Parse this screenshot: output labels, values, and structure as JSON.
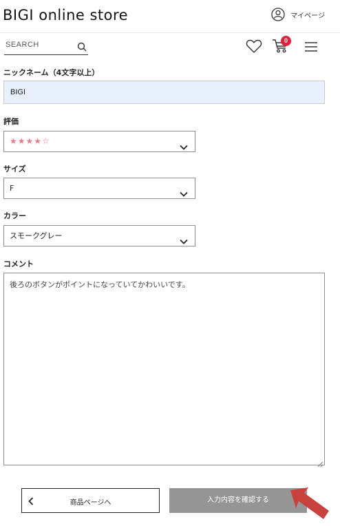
{
  "header": {
    "logo": "BIGI online store",
    "mypage_label": "マイページ"
  },
  "toolbar": {
    "search_placeholder": "SEARCH",
    "cart_count": "0"
  },
  "form": {
    "nickname": {
      "label": "ニックネーム（4文字以上）",
      "value": "BIGI"
    },
    "rating": {
      "label": "評価",
      "value": "★★★★☆",
      "stars": 4,
      "max_stars": 5
    },
    "size": {
      "label": "サイズ",
      "value": "F"
    },
    "color": {
      "label": "カラー",
      "value": "スモークグレー"
    },
    "comment": {
      "label": "コメント",
      "value": "後ろのボタンがポイントになっていてかわいいです。"
    }
  },
  "buttons": {
    "back_label": "商品ページへ",
    "confirm_label": "入力内容を確認する"
  },
  "colors": {
    "accent": "#e0223a",
    "arrow": "#c9413c",
    "confirm_bg": "#959595",
    "nickname_bg": "#e8f0fd",
    "star": "#e87a8a"
  }
}
